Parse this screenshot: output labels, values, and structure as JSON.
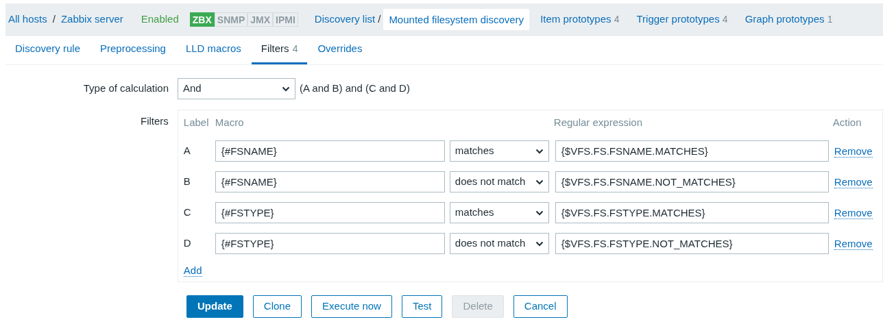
{
  "breadcrumbs": [
    {
      "label": "All hosts"
    },
    {
      "separator": "/",
      "label": "Zabbix server"
    }
  ],
  "status": "Enabled",
  "availability": [
    {
      "label": "ZBX",
      "on": true
    },
    {
      "label": "SNMP",
      "on": false
    },
    {
      "label": "JMX",
      "on": false
    },
    {
      "label": "IPMI",
      "on": false
    }
  ],
  "discovery_path": {
    "list": "Discovery list",
    "separator": "/",
    "current": "Mounted filesystem discovery"
  },
  "prototype_links": [
    {
      "label": "Item prototypes",
      "count": "4"
    },
    {
      "label": "Trigger prototypes",
      "count": "4"
    },
    {
      "label": "Graph prototypes",
      "count": "1"
    }
  ],
  "tabs": [
    {
      "label": "Discovery rule",
      "selected": false
    },
    {
      "label": "Preprocessing",
      "selected": false
    },
    {
      "label": "LLD macros",
      "selected": false
    },
    {
      "label": "Filters",
      "count": "4",
      "selected": true
    },
    {
      "label": "Overrides",
      "selected": false
    }
  ],
  "calculation": {
    "label": "Type of calculation",
    "value": "And",
    "formula": "(A and B) and (C and D)"
  },
  "filters": {
    "label": "Filters",
    "columns": [
      "Label",
      "Macro",
      "Regular expression",
      "Action"
    ],
    "rows": [
      {
        "label": "A",
        "macro": "{#FSNAME}",
        "operator": "matches",
        "regex": "{$VFS.FS.FSNAME.MATCHES}",
        "action": "Remove"
      },
      {
        "label": "B",
        "macro": "{#FSNAME}",
        "operator": "does not match",
        "regex": "{$VFS.FS.FSNAME.NOT_MATCHES}",
        "action": "Remove"
      },
      {
        "label": "C",
        "macro": "{#FSTYPE}",
        "operator": "matches",
        "regex": "{$VFS.FS.FSTYPE.MATCHES}",
        "action": "Remove"
      },
      {
        "label": "D",
        "macro": "{#FSTYPE}",
        "operator": "does not match",
        "regex": "{$VFS.FS.FSTYPE.NOT_MATCHES}",
        "action": "Remove"
      }
    ],
    "add": "Add"
  },
  "buttons": [
    {
      "label": "Update",
      "kind": "primary",
      "disabled": false
    },
    {
      "label": "Clone",
      "kind": "secondary",
      "disabled": false
    },
    {
      "label": "Execute now",
      "kind": "secondary",
      "disabled": false
    },
    {
      "label": "Test",
      "kind": "secondary",
      "disabled": false
    },
    {
      "label": "Delete",
      "kind": "secondary",
      "disabled": true
    },
    {
      "label": "Cancel",
      "kind": "secondary",
      "disabled": false
    }
  ]
}
